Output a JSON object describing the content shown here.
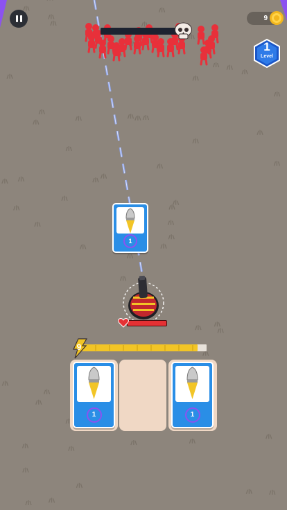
{
  "hud": {
    "coins": "9",
    "level_number": "1",
    "level_label": "Level"
  },
  "boss_health": {
    "fraction": 1.0
  },
  "player": {
    "health_fraction": 1.0
  },
  "xp": {
    "level": "9",
    "fraction": 0.93
  },
  "dropped_card": {
    "level": "1",
    "icon": "bullet-icon"
  },
  "deck": {
    "slots": [
      {
        "filled": true,
        "level": "1",
        "icon": "bullet-icon"
      },
      {
        "filled": false
      },
      {
        "filled": true,
        "level": "1",
        "icon": "bullet-icon"
      }
    ]
  },
  "colors": {
    "ground": "#8d857c",
    "enemy": "#e8303a",
    "card_blue": "#2a8ee6",
    "xp_yellow": "#f2c526",
    "health_red": "#e53134",
    "laser_blue": "#6a8af0"
  }
}
